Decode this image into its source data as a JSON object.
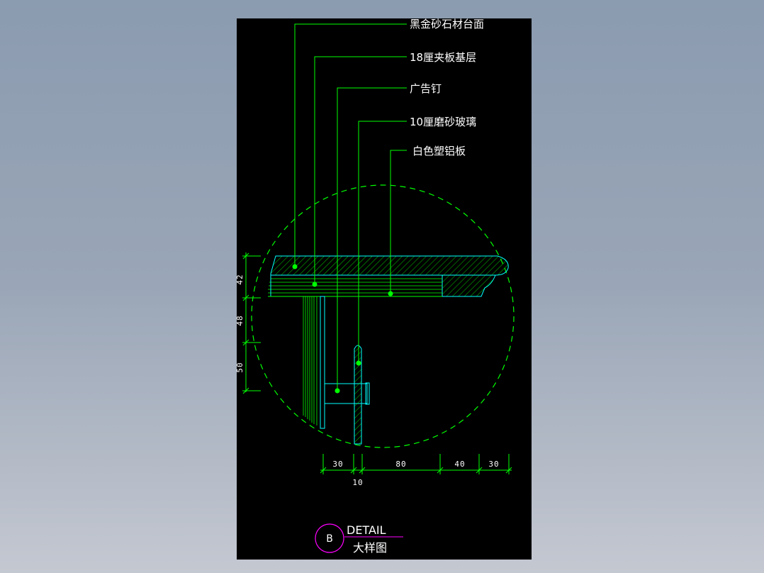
{
  "drawing": {
    "callouts": [
      {
        "label": "黑金砂石材台面"
      },
      {
        "label": "18厘夹板基层"
      },
      {
        "label": "广告钉"
      },
      {
        "label": "10厘磨砂玻璃"
      },
      {
        "label": "白色塑铝板"
      }
    ],
    "vertical_dims": [
      "42",
      "48",
      "50"
    ],
    "horizontal_dims": [
      "30",
      "80",
      "40",
      "30"
    ],
    "bottom_dim": "10",
    "detail_mark": "B",
    "detail_title_en": "DETAIL",
    "detail_title_cn": "大样图",
    "colors": {
      "background": "#000000",
      "leader": "#00ff00",
      "outline": "#00ffff",
      "detail_circle": "#ff00ff",
      "text": "#ffffff"
    }
  }
}
